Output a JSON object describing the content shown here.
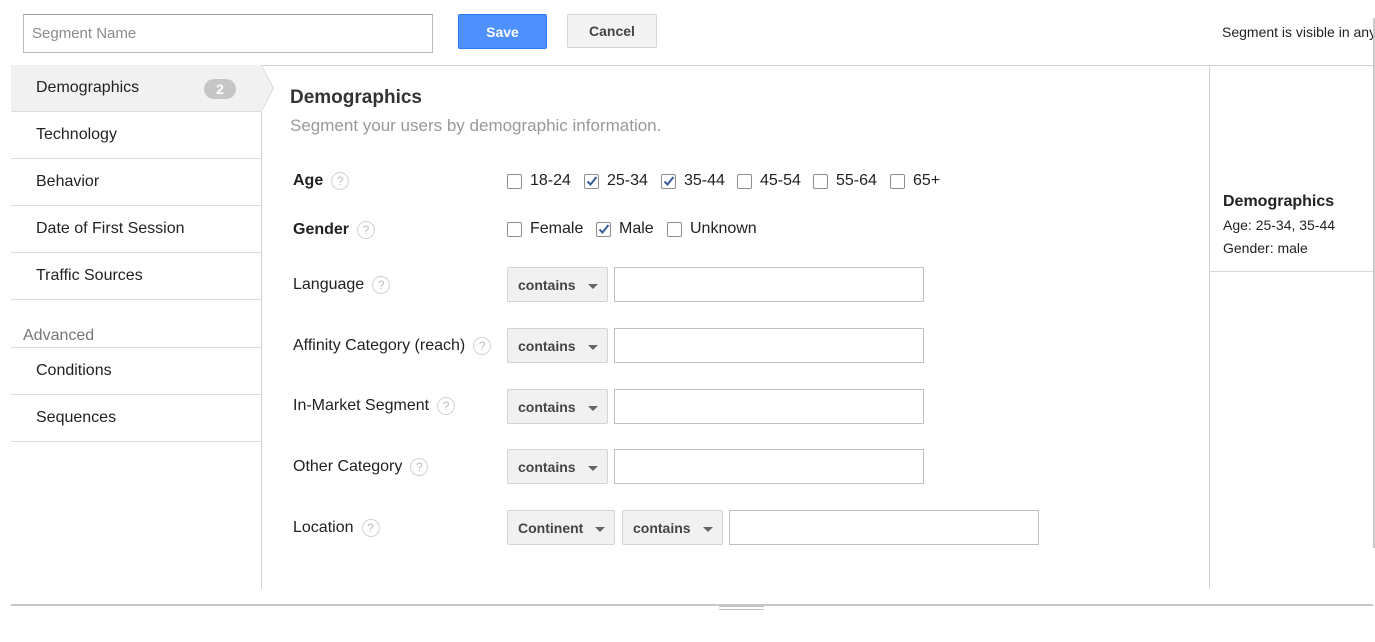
{
  "toolbar": {
    "segment_name_placeholder": "Segment Name",
    "segment_name_value": "",
    "save_label": "Save",
    "cancel_label": "Cancel",
    "visibility_text": "Segment is visible in any"
  },
  "sidebar": {
    "items": [
      {
        "label": "Demographics",
        "badge": "2",
        "active": true
      },
      {
        "label": "Technology"
      },
      {
        "label": "Behavior"
      },
      {
        "label": "Date of First Session"
      },
      {
        "label": "Traffic Sources"
      }
    ],
    "advanced_label": "Advanced",
    "advanced_items": [
      {
        "label": "Conditions"
      },
      {
        "label": "Sequences"
      }
    ]
  },
  "main": {
    "title": "Demographics",
    "subtitle": "Segment your users by demographic information.",
    "age": {
      "label": "Age",
      "help": "?",
      "options": [
        {
          "label": "18-24",
          "checked": false
        },
        {
          "label": "25-34",
          "checked": true
        },
        {
          "label": "35-44",
          "checked": true
        },
        {
          "label": "45-54",
          "checked": false
        },
        {
          "label": "55-64",
          "checked": false
        },
        {
          "label": "65+",
          "checked": false
        }
      ]
    },
    "gender": {
      "label": "Gender",
      "help": "?",
      "options": [
        {
          "label": "Female",
          "checked": false
        },
        {
          "label": "Male",
          "checked": true
        },
        {
          "label": "Unknown",
          "checked": false
        }
      ]
    },
    "filters": [
      {
        "label": "Language",
        "help": "?",
        "operator": "contains",
        "value": ""
      },
      {
        "label": "Affinity Category (reach)",
        "help": "?",
        "operator": "contains",
        "value": ""
      },
      {
        "label": "In-Market Segment",
        "help": "?",
        "operator": "contains",
        "value": ""
      },
      {
        "label": "Other Category",
        "help": "?",
        "operator": "contains",
        "value": ""
      }
    ],
    "location": {
      "label": "Location",
      "help": "?",
      "scope": "Continent",
      "operator": "contains",
      "value": ""
    }
  },
  "summary": {
    "title": "Demographics",
    "age_line": "Age: 25-34, 35-44",
    "gender_line": "Gender: male"
  },
  "colors": {
    "save_button": "#4d90fe",
    "active_nav_bg": "#f1f1f1",
    "badge_bg": "#c6c6c6"
  }
}
